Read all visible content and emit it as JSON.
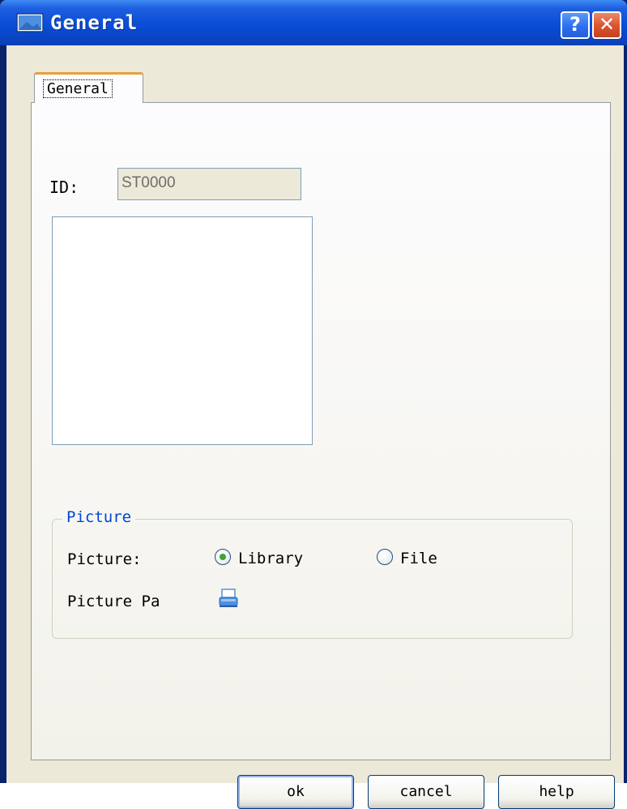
{
  "window": {
    "title": "General",
    "help_glyph": "?",
    "close_glyph": "✕"
  },
  "tabs": [
    {
      "label": "General",
      "selected": true
    }
  ],
  "fields": {
    "id_label": "ID:",
    "id_value": "ST0000"
  },
  "picture_group": {
    "title": "Picture",
    "picture_label": "Picture:",
    "options": [
      {
        "label": "Library",
        "checked": true
      },
      {
        "label": "File",
        "checked": false
      }
    ],
    "path_label": "Picture Pa",
    "browse_icon": "folder-browse-icon"
  },
  "buttons": {
    "ok": "ok",
    "cancel": "cancel",
    "help": "help"
  },
  "colors": {
    "titlebar": "#0b4fd8",
    "group_title": "#0046d5",
    "radio_checked": "#3ea23d",
    "tab_highlight": "#e6a03a"
  }
}
